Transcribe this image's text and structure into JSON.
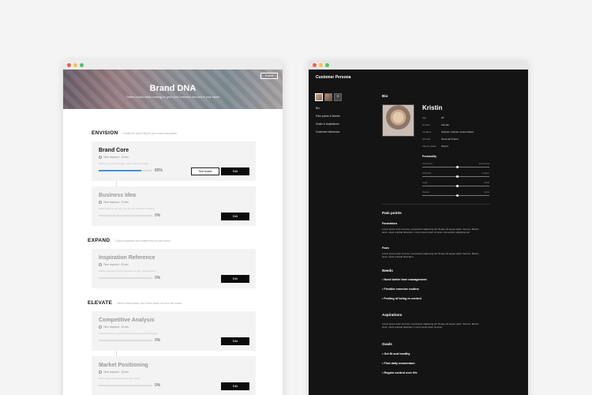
{
  "left_window": {
    "hero": {
      "title": "Brand DNA",
      "subtitle": "Define a solid brand strategy to grow your business and inform your brand",
      "export_label": "Export"
    },
    "sections": [
      {
        "title": "ENVISION",
        "description": "Create the solid DNA for your brand foundation",
        "cards": [
          {
            "title": "Brand Core",
            "time": "Time required : 15 min",
            "desc": "Define your brand purpose, values and personality",
            "pct_label": "80%",
            "pct": 80,
            "secondary_label": "See board",
            "primary_label": "Edit"
          },
          {
            "title": "Business Idea",
            "time": "Time required : 10 min",
            "desc": "Define what you do, who you do it for, and why it matters",
            "pct_label": "0%",
            "pct": 0,
            "primary_label": "Edit"
          }
        ]
      },
      {
        "title": "EXPAND",
        "description": "Collect inspiration and references for your brand",
        "cards": [
          {
            "title": "Inspiration Reference",
            "time": "Time required : 20 min",
            "desc": "Gather visual and verbal inspiration for your brand direction",
            "pct_label": "0%",
            "pct": 0,
            "primary_label": "Edit"
          }
        ]
      },
      {
        "title": "ELEVATE",
        "description": "Define what makes your brand stand out from the crowd",
        "cards": [
          {
            "title": "Competitive Analysis",
            "time": "Time required : 10 min",
            "desc": "Understand the competitive landscape and your advantages",
            "pct_label": "0%",
            "pct": 0,
            "primary_label": "Edit"
          },
          {
            "title": "Market Positioning",
            "time": "Time required : 15 min",
            "desc": "Define where your brand sits in the market",
            "pct_label": "0%",
            "pct": 0,
            "primary_label": "Edit"
          }
        ]
      }
    ],
    "colors": {
      "progress": "#4a8fd8",
      "button_dark": "#0b0b0b"
    }
  },
  "right_window": {
    "title": "Customer Persona",
    "add_icon": "+",
    "nav": [
      "Bio",
      "Pain points & Needs",
      "Goals & Aspirations",
      "Customer behaviors"
    ],
    "bio_label": "Bio",
    "name": "Kristin",
    "details": [
      {
        "k": "Age",
        "v": "28"
      },
      {
        "k": "Gender",
        "v": "Female"
      },
      {
        "k": "Location",
        "v": "Orlando, Florida, United States"
      },
      {
        "k": "Job title",
        "v": "Personal Trainer"
      },
      {
        "k": "Family status",
        "v": "Parent"
      }
    ],
    "personality_label": "Personality",
    "sliders": [
      {
        "left": "Introverted",
        "right": "Extroverted",
        "value": 0.5
      },
      {
        "left": "Analytical",
        "right": "Creative",
        "value": 0.5
      },
      {
        "left": "Loyal",
        "right": "Fickle",
        "value": 0.5
      },
      {
        "left": "Passive",
        "right": "Active",
        "value": 0.5
      }
    ],
    "pain_points_label": "Pain points",
    "frustrations_label": "Frustrations",
    "frustrations_text": "Lorem ipsum dolor sit amet, consectetur adipiscing elit. Neque elit augue quam rhoncus. Mauris amet, turpis volutpat bibendum. Lorem ipsum dolor sit amet, consectetur adipiscing elit.",
    "fears_label": "Fears",
    "fears_text": "Lorem ipsum dolor sit amet, consectetur adipiscing elit. Neque elit augue quam rhoncus. Mauris amet, turpis volutpat bibendum.",
    "needs_label": "Needs",
    "needs": [
      "Need better time management",
      "Flexible exercise routine",
      "Feeling of being in control"
    ],
    "aspirations_label": "Aspirations",
    "aspirations_text": "Lorem ipsum dolor sit amet, consectetur adipiscing elit. Neque elit augue quam rhoncus. Mauris amet, turpis volutpat bibendum. Lorem ipsum dolor sit amet.",
    "goals_label": "Goals",
    "goals": [
      "Get fit and healthy",
      "Find daily momentum",
      "Regain control over life"
    ]
  }
}
